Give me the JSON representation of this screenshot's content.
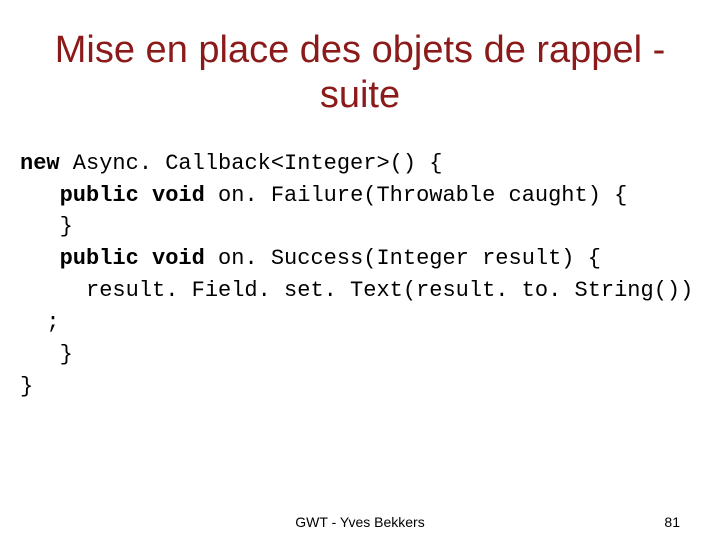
{
  "title": "Mise en place des objets de rappel - suite",
  "code": {
    "kw_new": "new",
    "l1_rest": " Async. Callback<Integer>() {",
    "indent1": "   ",
    "kw_public1": "public",
    "kw_void1": " void",
    "l2_rest": " on. Failure(Throwable caught) {",
    "l3": "   }",
    "kw_public2": "public",
    "kw_void2": " void",
    "l4_rest": " on. Success(Integer result) {",
    "l5": "     result. Field. set. Text(result. to. String())",
    "l6": "  ;",
    "l7": "   }",
    "l8": "}"
  },
  "footer": {
    "text": "GWT - Yves Bekkers",
    "page": "81"
  }
}
